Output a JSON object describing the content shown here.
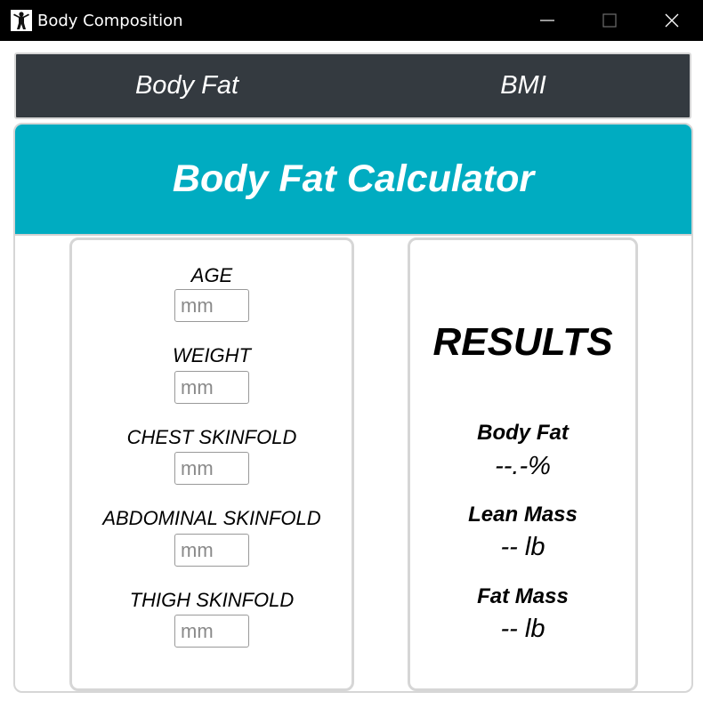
{
  "window": {
    "title": "Body Composition",
    "icon": "person-figure-icon"
  },
  "nav": {
    "tabs": [
      {
        "label": "Body Fat"
      },
      {
        "label": "BMI"
      }
    ]
  },
  "calculator": {
    "title": "Body Fat Calculator",
    "header_color": "#00acc1"
  },
  "inputs": [
    {
      "label": "AGE",
      "value": "",
      "placeholder": "mm"
    },
    {
      "label": "WEIGHT",
      "value": "",
      "placeholder": "mm"
    },
    {
      "label": "CHEST SKINFOLD",
      "value": "",
      "placeholder": "mm"
    },
    {
      "label": "ABDOMINAL SKINFOLD",
      "value": "",
      "placeholder": "mm"
    },
    {
      "label": "THIGH SKINFOLD",
      "value": "",
      "placeholder": "mm"
    }
  ],
  "results": {
    "title": "RESULTS",
    "items": [
      {
        "label": "Body Fat",
        "value": "--.-%"
      },
      {
        "label": "Lean Mass",
        "value": "-- lb"
      },
      {
        "label": "Fat Mass",
        "value": "-- lb"
      }
    ]
  }
}
